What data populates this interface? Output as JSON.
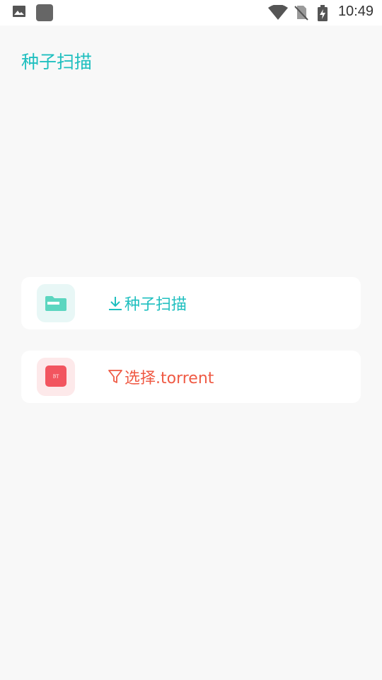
{
  "status_bar": {
    "time": "10:49",
    "left_icons": [
      "image-icon",
      "app-square-icon"
    ],
    "right_icons": [
      "wifi-icon",
      "no-sim-icon",
      "battery-charging-icon"
    ]
  },
  "page": {
    "title": "种子扫描"
  },
  "cards": [
    {
      "icon": "folder-icon",
      "label_icon": "download-icon",
      "label": "种子扫描",
      "color": "#1fbfbf",
      "icon_bg": "#e8f7f6"
    },
    {
      "icon": "bt-file-icon",
      "icon_text": "BT",
      "label_icon": "filter-icon",
      "label": "选择.torrent",
      "color": "#ef5a44",
      "icon_bg": "#fde9ea"
    }
  ],
  "colors": {
    "background": "#f8f8f8",
    "teal": "#1fbfbf",
    "folder_green": "#5cd6c0",
    "red_orange": "#ef5a44",
    "bt_red": "#f2555f"
  }
}
